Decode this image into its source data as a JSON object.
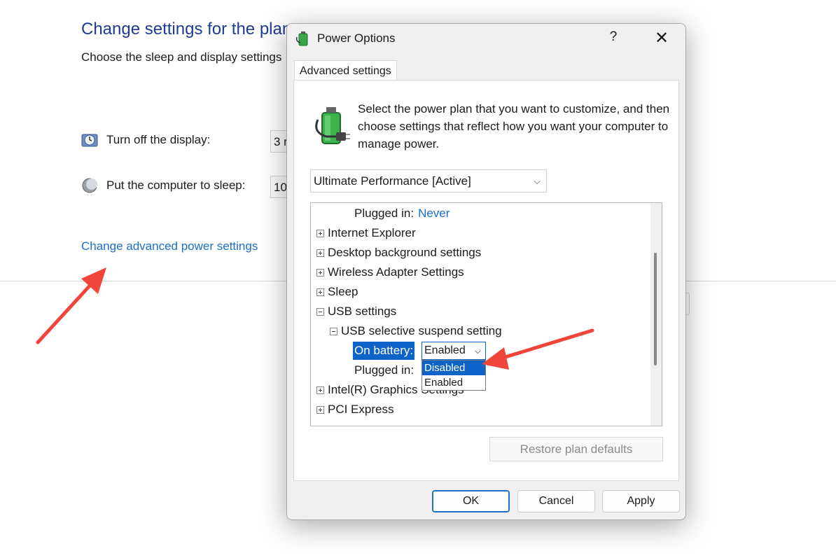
{
  "background": {
    "title": "Change settings for the plan",
    "subtitle": "Choose the sleep and display settings",
    "display_label": "Turn off the display:",
    "display_value": "3 m",
    "sleep_label": "Put the computer to sleep:",
    "sleep_value": "10",
    "advanced_link": "Change advanced power settings"
  },
  "dialog": {
    "title": "Power Options",
    "help_label": "?",
    "close_label": "✕",
    "tab_label": "Advanced settings",
    "intro": "Select the power plan that you want to customize, and then choose settings that reflect how you want your computer to manage power.",
    "plan_selected": "Ultimate Performance [Active]",
    "tree": {
      "plugged_in_label": "Plugged in:",
      "plugged_in_value": "Never",
      "items": [
        "Internet Explorer",
        "Desktop background settings",
        "Wireless Adapter Settings",
        "Sleep",
        "USB settings"
      ],
      "usb_child": "USB selective suspend setting",
      "on_battery_label": "On battery:",
      "on_battery_value": "Enabled",
      "plugged_in_label_2": "Plugged in:",
      "after_items": [
        "Intel(R) Graphics Settings",
        "PCI Express"
      ],
      "dropdown_options": [
        "Disabled",
        "Enabled"
      ]
    },
    "restore_label": "Restore plan defaults",
    "ok_label": "OK",
    "cancel_label": "Cancel",
    "apply_label": "Apply"
  },
  "colors": {
    "accent": "#0d63c7",
    "link": "#1a6fc9",
    "annotation_arrow": "#f0453a"
  },
  "icons": [
    "clock-icon",
    "moon-icon",
    "battery-plug-icon"
  ]
}
